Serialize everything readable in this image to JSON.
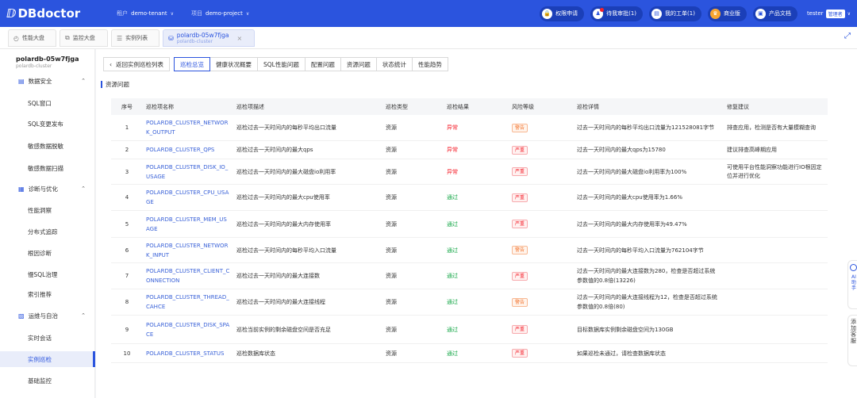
{
  "topbar": {
    "logo_text": "DBdoctor",
    "tenant_label": "租户",
    "tenant_value": "demo-tenant",
    "project_label": "项目",
    "project_value": "demo-project",
    "buttons": [
      {
        "label": "权限申请",
        "icon": "lock-icon"
      },
      {
        "label": "待我审批(1)",
        "icon": "user-approve-icon"
      },
      {
        "label": "我的工单(1)",
        "icon": "ticket-icon"
      },
      {
        "label": "商业版",
        "icon": "crown-icon"
      },
      {
        "label": "产品文档",
        "icon": "doc-icon"
      }
    ],
    "user_name": "tester",
    "user_role": "管理者"
  },
  "tabs": [
    {
      "label": "性能大盘",
      "icon": "dashboard-icon"
    },
    {
      "label": "监控大盘",
      "icon": "monitor-icon"
    },
    {
      "label": "实例列表",
      "icon": "list-icon"
    },
    {
      "label": "polardb-05w7fjga",
      "sublabel": "polardb-cluster",
      "icon": "database-icon",
      "active": true
    }
  ],
  "sidebar": {
    "instance_name": "polardb-05w7fjga",
    "instance_type": "polardb-cluster",
    "groups": [
      {
        "label": "数据安全",
        "items": [
          "SQL窗口",
          "SQL变更发布",
          "敏感数据脱敏",
          "敏感数据扫描"
        ]
      },
      {
        "label": "诊断与优化",
        "items": [
          "性能洞察",
          "分布式追踪",
          "根因诊断",
          "慢SQL治理",
          "索引推荐"
        ]
      },
      {
        "label": "运维与自治",
        "items": [
          "实时会话",
          "实例巡检",
          "基础监控"
        ]
      }
    ],
    "active_item": "实例巡检"
  },
  "main": {
    "back_button": "返回实例巡检列表",
    "nav_tabs": [
      "巡检总览",
      "健康状况概要",
      "SQL性能问题",
      "配置问题",
      "资源问题",
      "状态统计",
      "性能趋势"
    ],
    "active_nav": "巡检总览",
    "section_title": "资源问题",
    "columns": [
      "序号",
      "巡检项名称",
      "巡检项描述",
      "巡检类型",
      "巡检结果",
      "风险等级",
      "巡检详情",
      "修复建议"
    ],
    "rows": [
      {
        "no": "1",
        "name": "POLARDB_CLUSTER_NETWORK_OUTPUT",
        "desc": "巡检过去一天时间内的每秒平均出口流量",
        "type": "资源",
        "result": "异常",
        "risk": "警告",
        "detail": "过去一天时间内的每秒平均出口流量为121528081字节",
        "suggestion": "排查应用，检测是否有大量模糊查询"
      },
      {
        "no": "2",
        "name": "POLARDB_CLUSTER_QPS",
        "desc": "巡检过去一天时间内的最大qps",
        "type": "资源",
        "result": "异常",
        "risk": "严重",
        "detail": "过去一天时间内的最大qps为15780",
        "suggestion": "建议排查高峰期应用"
      },
      {
        "no": "3",
        "name": "POLARDB_CLUSTER_DISK_IO_USAGE",
        "desc": "巡检过去一天时间内的最大磁盘io利用率",
        "type": "资源",
        "result": "异常",
        "risk": "严重",
        "detail": "过去一天时间内的最大磁盘io利用率为100%",
        "suggestion": "可使用平台性能洞察功能进行IO根因定位并进行优化"
      },
      {
        "no": "4",
        "name": "POLARDB_CLUSTER_CPU_USAGE",
        "desc": "巡检过去一天时间内的最大cpu使用率",
        "type": "资源",
        "result": "通过",
        "risk": "严重",
        "detail": "过去一天时间内的最大cpu使用率为1.66%",
        "suggestion": ""
      },
      {
        "no": "5",
        "name": "POLARDB_CLUSTER_MEM_USAGE",
        "desc": "巡检过去一天时间内的最大内存使用率",
        "type": "资源",
        "result": "通过",
        "risk": "严重",
        "detail": "过去一天时间内的最大内存使用率为49.47%",
        "suggestion": ""
      },
      {
        "no": "6",
        "name": "POLARDB_CLUSTER_NETWORK_INPUT",
        "desc": "巡检过去一天时间内的每秒平均入口流量",
        "type": "资源",
        "result": "通过",
        "risk": "警告",
        "detail": "过去一天时间内的每秒平均入口流量为762104字节",
        "suggestion": ""
      },
      {
        "no": "7",
        "name": "POLARDB_CLUSTER_CLIENT_CONNECTION",
        "desc": "巡检过去一天时间内的最大连接数",
        "type": "资源",
        "result": "通过",
        "risk": "严重",
        "detail": "过去一天时间内的最大连接数为280，检查是否超过系统参数值的0.8倍(13226)",
        "suggestion": ""
      },
      {
        "no": "8",
        "name": "POLARDB_CLUSTER_THREAD_CAHCE",
        "desc": "巡检过去一天时间内的最大连接线程",
        "type": "资源",
        "result": "通过",
        "risk": "警告",
        "detail": "过去一天时间内的最大连接线程为12，检查是否超过系统参数值的0.8倍(80)",
        "suggestion": ""
      },
      {
        "no": "9",
        "name": "POLARDB_CLUSTER_DISK_SPACE",
        "desc": "巡检当前实例的剩余磁盘空间是否充足",
        "type": "资源",
        "result": "通过",
        "risk": "严重",
        "detail": "目标数据库实例剩余磁盘空间为130GB",
        "suggestion": ""
      },
      {
        "no": "10",
        "name": "POLARDB_CLUSTER_STATUS",
        "desc": "巡检数据库状态",
        "type": "资源",
        "result": "通过",
        "risk": "严重",
        "detail": "如果巡检未通过，请检查数据库状态",
        "suggestion": ""
      }
    ]
  },
  "floating": {
    "tool1_text": "AI助手",
    "tool2_text": "添加客服"
  },
  "colors": {
    "brand": "#2b54de",
    "abnormal": "#f5222d",
    "pass": "#18a84a",
    "warn": "#f3722c"
  }
}
